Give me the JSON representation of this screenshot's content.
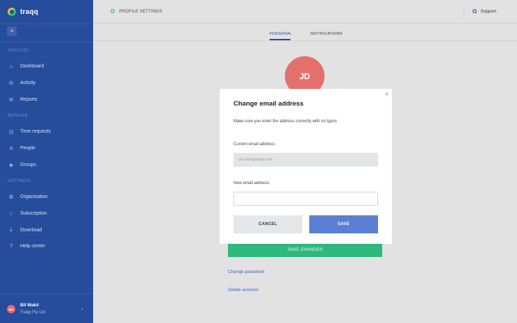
{
  "app": {
    "name": "traqq"
  },
  "sidebar": {
    "sections": [
      {
        "title": "ANALYZE",
        "items": [
          {
            "label": "Dashboard",
            "icon": "home-icon"
          },
          {
            "label": "Activity",
            "icon": "bar-chart-icon"
          },
          {
            "label": "Reports",
            "icon": "report-icon"
          }
        ]
      },
      {
        "title": "MANAGE",
        "items": [
          {
            "label": "Time requests",
            "icon": "clock-icon"
          },
          {
            "label": "People",
            "icon": "people-icon"
          },
          {
            "label": "Groups",
            "icon": "layers-icon"
          }
        ]
      },
      {
        "title": "SETTINGS",
        "items": [
          {
            "label": "Organization",
            "icon": "gear-icon"
          },
          {
            "label": "Subscription",
            "icon": "star-icon"
          },
          {
            "label": "Download",
            "icon": "download-icon"
          },
          {
            "label": "Help center",
            "icon": "help-icon"
          }
        ]
      }
    ],
    "user": {
      "initials": "BW",
      "name": "Bil Wakil",
      "company": "Traqq Pty Ltd"
    }
  },
  "header": {
    "title": "PROFILE SETTINGS",
    "support_label": "Support"
  },
  "tabs": [
    {
      "label": "PERSONAL",
      "active": true
    },
    {
      "label": "NOTIFICATIONS",
      "active": false
    }
  ],
  "profile": {
    "initials": "JD",
    "save_changes_label": "SAVE CHANGES",
    "change_password_label": "Change password",
    "delete_account_label": "Delete account"
  },
  "modal": {
    "title": "Change email address",
    "description": "Make sure you enter the address correctly with no typos",
    "current_label": "Current email address:",
    "current_value": "bil.wakil@traqq.com",
    "new_label": "New email address:",
    "new_value": "",
    "cancel_label": "CANCEL",
    "save_label": "SAVE",
    "close_symbol": "×"
  },
  "colors": {
    "sidebar": "#264c9c",
    "accent_green": "#2db87d",
    "primary_blue": "#5b80d3",
    "avatar": "#e4706c"
  }
}
